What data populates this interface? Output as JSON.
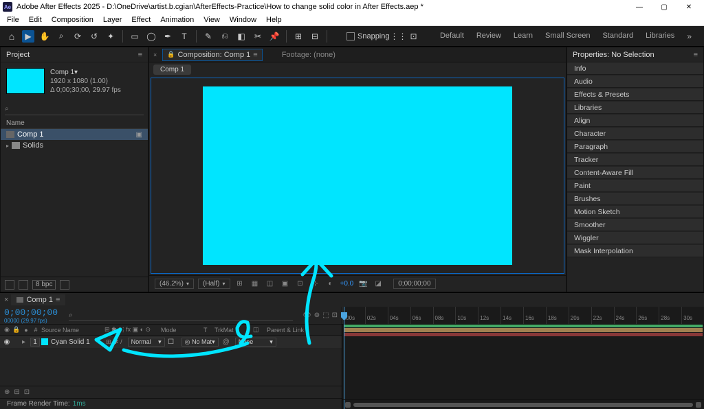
{
  "titlebar": {
    "app": "Adobe After Effects 2025",
    "path": "D:\\OneDrive\\artist.b.cgian\\AfterEffects-Practice\\How to change solid color in After Effects.aep *",
    "logo_text": "Ae"
  },
  "menu": [
    "File",
    "Edit",
    "Composition",
    "Layer",
    "Effect",
    "Animation",
    "View",
    "Window",
    "Help"
  ],
  "toolbar": {
    "snapping_label": "Snapping"
  },
  "workspaces": [
    "Default",
    "Review",
    "Learn",
    "Small Screen",
    "Standard",
    "Libraries"
  ],
  "project": {
    "title": "Project",
    "comp_name": "Comp 1▾",
    "resolution": "1920 x 1080 (1.00)",
    "duration": "Δ 0;00;30;00, 29.97 fps",
    "search_placeholder": "⌕",
    "col_name": "Name",
    "items": [
      {
        "label": "Comp 1",
        "selected": true,
        "type": "comp"
      },
      {
        "label": "Solids",
        "selected": false,
        "type": "folder"
      }
    ],
    "bpc": "8 bpc"
  },
  "composition": {
    "tab_label": "Composition: Comp 1",
    "footage_label": "Footage: (none)",
    "subtab": "Comp 1",
    "zoom": "(46.2%)",
    "res": "(Half)",
    "exposure": "+0.0",
    "timecode": "0;00;00;00"
  },
  "properties": {
    "header": "Properties: No Selection",
    "items": [
      "Info",
      "Audio",
      "Effects & Presets",
      "Libraries",
      "Align",
      "Character",
      "Paragraph",
      "Tracker",
      "Content-Aware Fill",
      "Paint",
      "Brushes",
      "Motion Sketch",
      "Smoother",
      "Wiggler",
      "Mask Interpolation"
    ]
  },
  "timeline": {
    "tab": "Comp 1",
    "current_time": "0;00;00;00",
    "fps_label": "00000 (29.97 fps)",
    "search_placeholder": "⌕",
    "col_source": "Source Name",
    "col_mode": "Mode",
    "col_trk": "TrkMat",
    "col_parent": "Parent & Link",
    "layer": {
      "index": "1",
      "name": "Cyan Solid 1",
      "mode": "Normal",
      "trk": "No Mat",
      "parent": "None"
    },
    "render_label": "Frame Render Time:",
    "render_value": "1ms",
    "ticks": [
      ":00s",
      "02s",
      "04s",
      "06s",
      "08s",
      "10s",
      "12s",
      "14s",
      "16s",
      "18s",
      "20s",
      "22s",
      "24s",
      "26s",
      "28s",
      "30s"
    ]
  }
}
